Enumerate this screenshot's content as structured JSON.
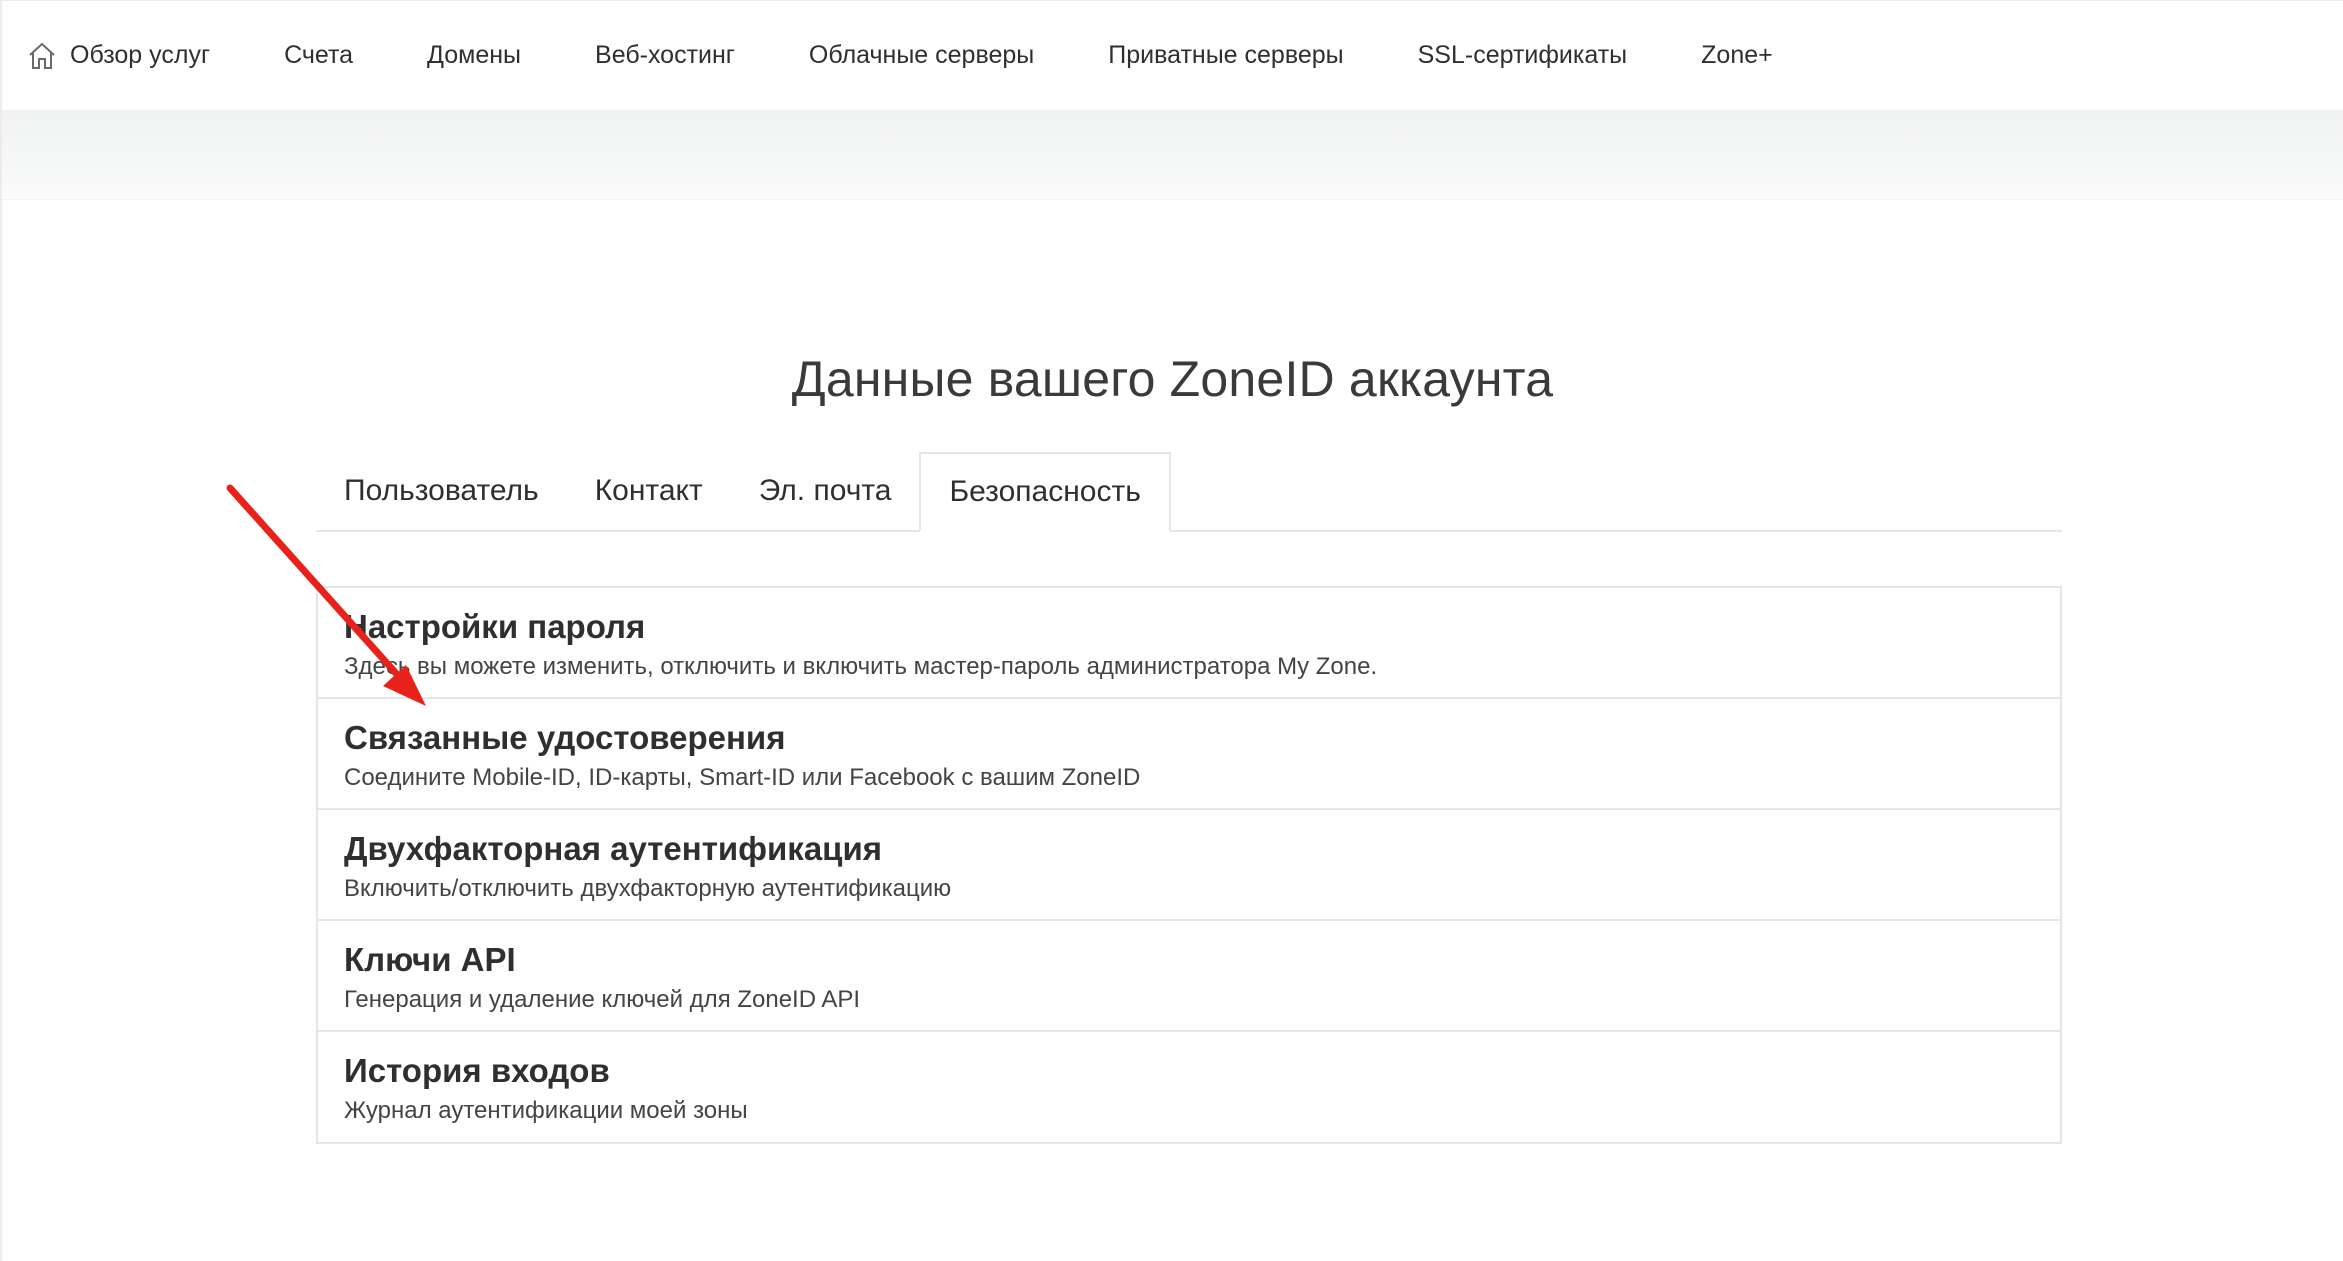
{
  "nav": {
    "items": [
      {
        "label": "Обзор услуг",
        "icon": "home-icon"
      },
      {
        "label": "Счета"
      },
      {
        "label": "Домены"
      },
      {
        "label": "Веб-хостинг"
      },
      {
        "label": "Облачные серверы"
      },
      {
        "label": "Приватные серверы"
      },
      {
        "label": "SSL-сертификаты"
      },
      {
        "label": "Zone+"
      }
    ]
  },
  "page": {
    "title": "Данные вашего ZoneID аккаунта"
  },
  "tabs": [
    {
      "label": "Пользователь",
      "active": false
    },
    {
      "label": "Контакт",
      "active": false
    },
    {
      "label": "Эл. почта",
      "active": false
    },
    {
      "label": "Безопасность",
      "active": true
    }
  ],
  "security": {
    "items": [
      {
        "title": "Настройки пароля",
        "desc": "Здесь вы можете изменить, отключить и включить мастер-пароль администратора My Zone."
      },
      {
        "title": "Связанные удостоверения",
        "desc": "Соедините Mobile-ID, ID-карты, Smart-ID или Facebook с вашим ZoneID"
      },
      {
        "title": "Двухфакторная аутентификация",
        "desc": "Включить/отключить двухфакторную аутентификацию"
      },
      {
        "title": "Ключи API",
        "desc": "Генерация и удаление ключей для ZoneID API"
      },
      {
        "title": "История входов",
        "desc": "Журнал аутентификации моей зоны"
      }
    ]
  },
  "colors": {
    "annotation_arrow": "#e8221b",
    "border": "#e6e6e6",
    "text": "#2f2f2f"
  }
}
